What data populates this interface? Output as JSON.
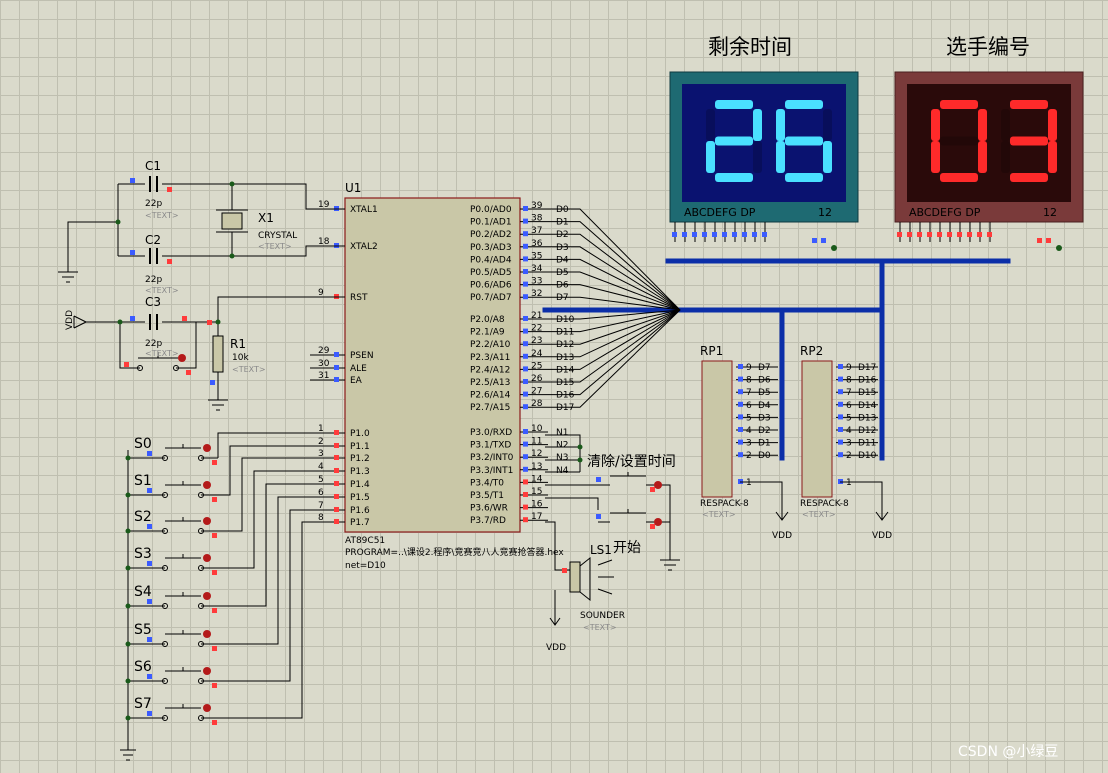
{
  "titles": {
    "time_display": "剩余时间",
    "player_display": "选手编号"
  },
  "displays": {
    "time": {
      "value": "26",
      "legend": "ABCDEFG  DP",
      "digits_num": "12",
      "color": "#4ae0ff",
      "frame": "#1e6a72"
    },
    "player": {
      "value": "03",
      "legend": "ABCDEFG  DP",
      "digits_num": "12",
      "color": "#ff2a2a",
      "frame": "#7a3a3a"
    }
  },
  "components": {
    "u1_ref": "U1",
    "u1_part": "AT89C51",
    "u1_program": "PROGRAM=..\\课设2.程序\\竞赛竞八人竞赛抢答器.hex",
    "u1_net": "net=D10",
    "c1": "C1",
    "c1_val": "22p",
    "c2": "C2",
    "c2_val": "22p",
    "c3": "C3",
    "c3_val": "22p",
    "x1": "X1",
    "x1_val": "CRYSTAL",
    "r1": "R1",
    "r1_val": "10k",
    "rp1": "RP1",
    "rp1_part": "RESPACK-8",
    "rp2": "RP2",
    "rp2_part": "RESPACK-8",
    "text_placeholder": "<TEXT>",
    "vdd": "VDD",
    "sounder": "SOUNDER",
    "ls1": "LS1"
  },
  "labels": {
    "clear_set": "清除/设置时间",
    "start": "开始",
    "watermark": "CSDN @小绿豆"
  },
  "u1_left_pins": [
    {
      "num": "19",
      "name": "XTAL1"
    },
    {
      "num": "18",
      "name": "XTAL2"
    },
    {
      "num": "9",
      "name": "RST"
    },
    {
      "num": "29",
      "name": "PSEN"
    },
    {
      "num": "30",
      "name": "ALE"
    },
    {
      "num": "31",
      "name": "EA"
    },
    {
      "num": "1",
      "name": "P1.0"
    },
    {
      "num": "2",
      "name": "P1.1"
    },
    {
      "num": "3",
      "name": "P1.2"
    },
    {
      "num": "4",
      "name": "P1.3"
    },
    {
      "num": "5",
      "name": "P1.4"
    },
    {
      "num": "6",
      "name": "P1.5"
    },
    {
      "num": "7",
      "name": "P1.6"
    },
    {
      "num": "8",
      "name": "P1.7"
    }
  ],
  "u1_right_pins": [
    {
      "num": "39",
      "name": "P0.0/AD0",
      "net": "D0"
    },
    {
      "num": "38",
      "name": "P0.1/AD1",
      "net": "D1"
    },
    {
      "num": "37",
      "name": "P0.2/AD2",
      "net": "D2"
    },
    {
      "num": "36",
      "name": "P0.3/AD3",
      "net": "D3"
    },
    {
      "num": "35",
      "name": "P0.4/AD4",
      "net": "D4"
    },
    {
      "num": "34",
      "name": "P0.5/AD5",
      "net": "D5"
    },
    {
      "num": "33",
      "name": "P0.6/AD6",
      "net": "D6"
    },
    {
      "num": "32",
      "name": "P0.7/AD7",
      "net": "D7"
    },
    {
      "num": "21",
      "name": "P2.0/A8",
      "net": "D10"
    },
    {
      "num": "22",
      "name": "P2.1/A9",
      "net": "D11"
    },
    {
      "num": "23",
      "name": "P2.2/A10",
      "net": "D12"
    },
    {
      "num": "24",
      "name": "P2.3/A11",
      "net": "D13"
    },
    {
      "num": "25",
      "name": "P2.4/A12",
      "net": "D14"
    },
    {
      "num": "26",
      "name": "P2.5/A13",
      "net": "D15"
    },
    {
      "num": "27",
      "name": "P2.6/A14",
      "net": "D16"
    },
    {
      "num": "28",
      "name": "P2.7/A15",
      "net": "D17"
    },
    {
      "num": "10",
      "name": "P3.0/RXD",
      "net": "N1"
    },
    {
      "num": "11",
      "name": "P3.1/TXD",
      "net": "N2"
    },
    {
      "num": "12",
      "name": "P3.2/INT0",
      "net": "N3"
    },
    {
      "num": "13",
      "name": "P3.3/INT1",
      "net": "N4"
    },
    {
      "num": "14",
      "name": "P3.4/T0",
      "net": ""
    },
    {
      "num": "15",
      "name": "P3.5/T1",
      "net": ""
    },
    {
      "num": "16",
      "name": "P3.6/WR",
      "net": ""
    },
    {
      "num": "17",
      "name": "P3.7/RD",
      "net": ""
    }
  ],
  "rp1_pins": [
    {
      "num": "9",
      "net": "D7"
    },
    {
      "num": "8",
      "net": "D6"
    },
    {
      "num": "7",
      "net": "D5"
    },
    {
      "num": "6",
      "net": "D4"
    },
    {
      "num": "5",
      "net": "D3"
    },
    {
      "num": "4",
      "net": "D2"
    },
    {
      "num": "3",
      "net": "D1"
    },
    {
      "num": "2",
      "net": "D0"
    },
    {
      "num": "1",
      "net": ""
    }
  ],
  "rp2_pins": [
    {
      "num": "9",
      "net": "D17"
    },
    {
      "num": "8",
      "net": "D16"
    },
    {
      "num": "7",
      "net": "D15"
    },
    {
      "num": "6",
      "net": "D14"
    },
    {
      "num": "5",
      "net": "D13"
    },
    {
      "num": "4",
      "net": "D12"
    },
    {
      "num": "3",
      "net": "D11"
    },
    {
      "num": "2",
      "net": "D10"
    },
    {
      "num": "1",
      "net": ""
    }
  ],
  "switches": [
    "S0",
    "S1",
    "S2",
    "S3",
    "S4",
    "S5",
    "S6",
    "S7"
  ]
}
